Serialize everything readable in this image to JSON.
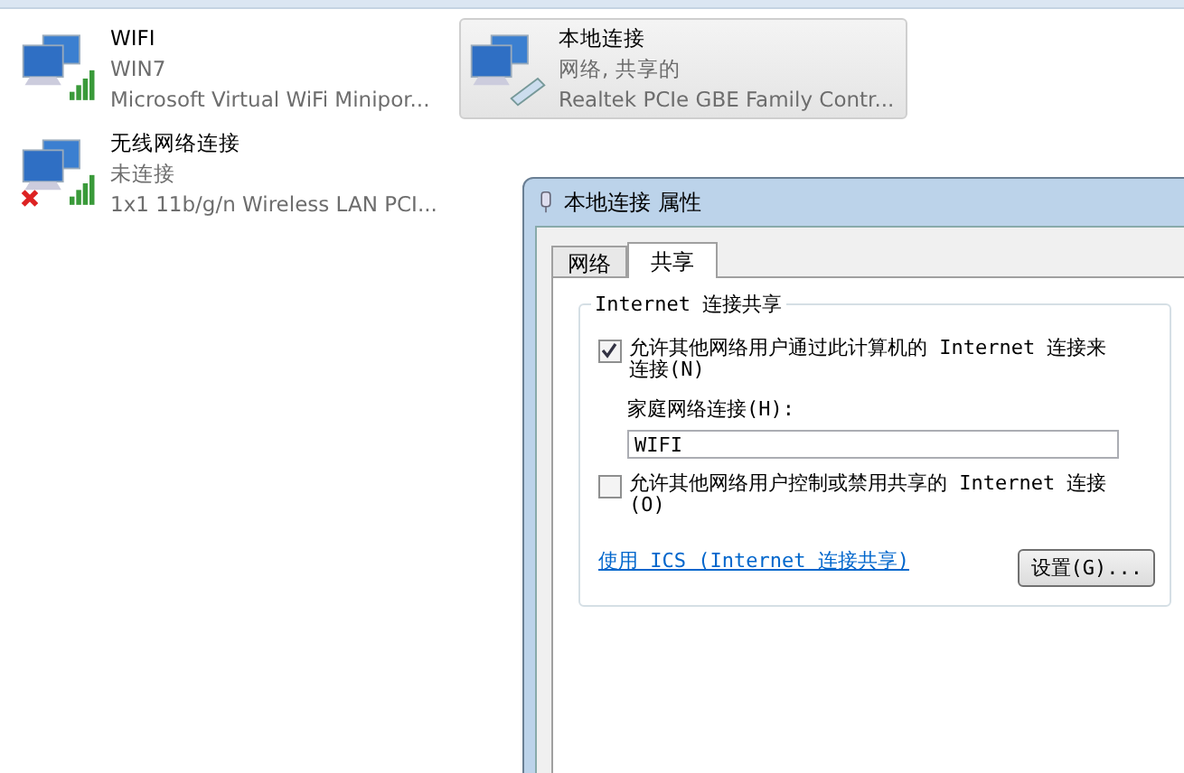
{
  "connections": [
    {
      "name": "WIFI",
      "status": "WIN7",
      "adapter": "Microsoft Virtual WiFi Minipor...",
      "kind": "wireless",
      "disconnected": false,
      "selected": false
    },
    {
      "name": "本地连接",
      "status": "网络, 共享的",
      "adapter": "Realtek PCIe GBE Family Contr...",
      "kind": "wired",
      "disconnected": false,
      "selected": true
    },
    {
      "name": "无线网络连接",
      "status": "未连接",
      "adapter": "1x1 11b/g/n Wireless LAN PCI...",
      "kind": "wireless",
      "disconnected": true,
      "selected": false
    }
  ],
  "dialog": {
    "title": "本地连接 属性",
    "tabs": [
      {
        "label": "网络",
        "selected": false
      },
      {
        "label": "共享",
        "selected": true
      }
    ],
    "group_title": "Internet 连接共享",
    "allow_connect": {
      "label": "允许其他网络用户通过此计算机的 Internet 连接来连接(N)",
      "checked": true
    },
    "home_network_label": "家庭网络连接(H):",
    "home_network_value": "WIFI",
    "allow_control": {
      "label": "允许其他网络用户控制或禁用共享的 Internet 连接(O)",
      "checked": false
    },
    "link": "使用 ICS (Internet 连接共享)",
    "settings_button": "设置(G)..."
  }
}
